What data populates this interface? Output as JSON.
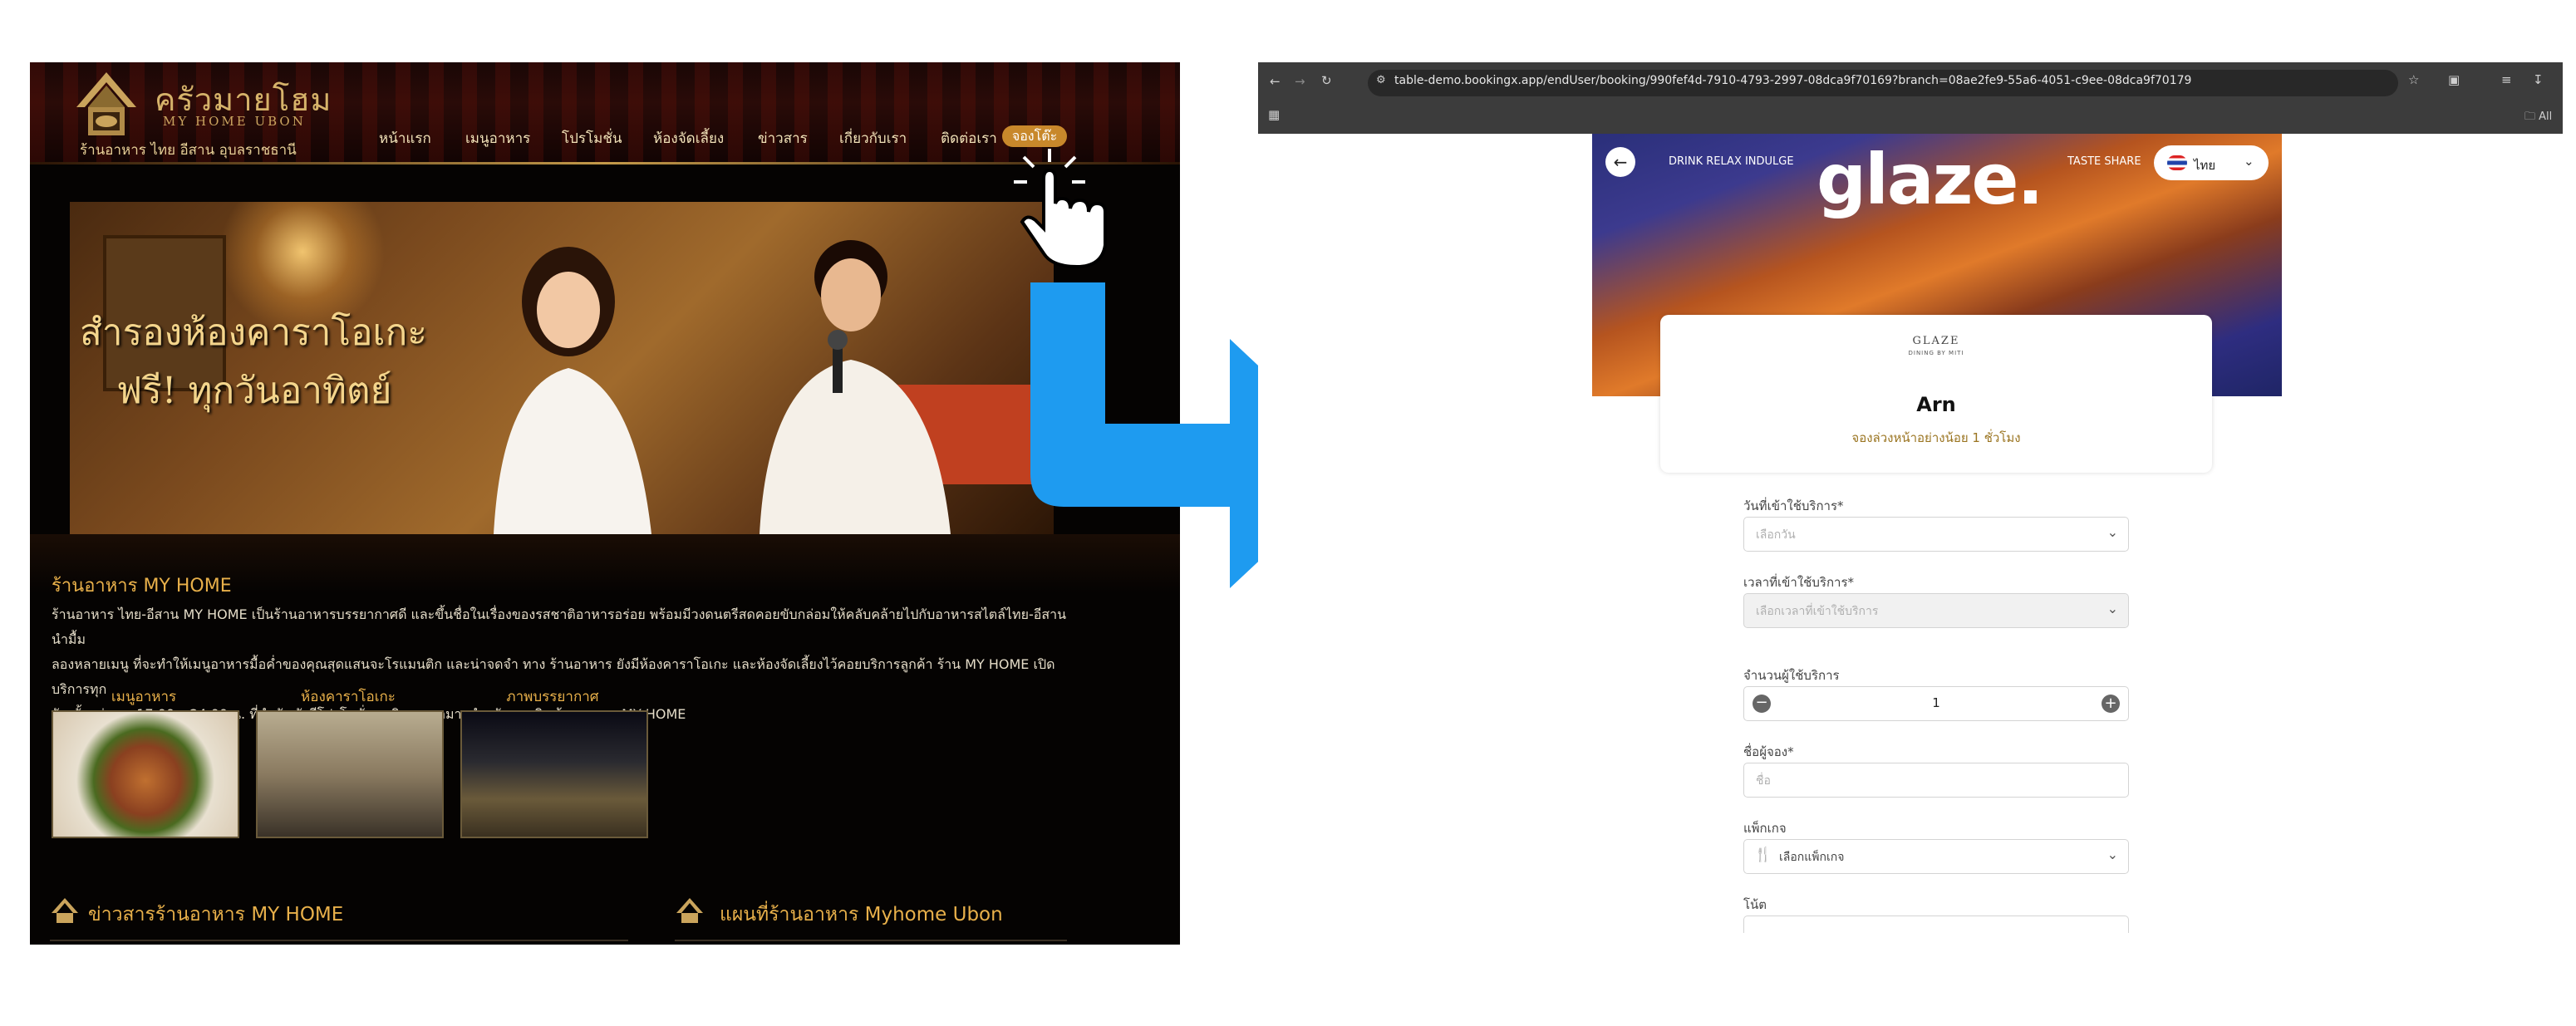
{
  "left_site": {
    "logo": {
      "name": "ครัวมายโฮม",
      "sub": "MY HOME UBON",
      "caption": "ร้านอาหาร ไทย อีสาน อุบลราชธานี"
    },
    "nav": [
      "หน้าแรก",
      "เมนูอาหาร",
      "โปรโมชั่น",
      "ห้องจัดเลี้ยง",
      "ข่าวสาร",
      "เกี่ยวกับเรา",
      "ติดต่อเรา",
      "จองโต๊ะ"
    ],
    "banner": {
      "line1": "สำรองห้องคาราโอเกะ",
      "line2": "ฟรี! ทุกวันอาทิตย์"
    },
    "section_title": "ร้านอาหาร MY HOME",
    "body": [
      "ร้านอาหาร ไทย-อีสาน MY HOME เป็นร้านอาหารบรรยากาศดี และขึ้นชื่อในเรื่องของรสชาติอาหารอร่อย พร้อมมีวงดนตรีสดคอยขับกล่อมให้คลับคล้ายไปกับอาหารสไตล์ไทย-อีสาน นำมื้ม",
      "ลองหลายเมนู ที่จะทำให้เมนูอาหารมื้อค่ำของคุณสุดแสนจะโรแมนติก และน่าจดจำ ทาง ร้านอาหาร ยังมีห้องคาราโอเกะ และห้องจัดเลี้ยงไว้คอยบริการลูกค้า ร้าน MY HOME เปิดบริการทุก",
      "วัน ตั้งแต่เวลา 17.00 – 24.00 น. ที่สำคัญยังมีโปรโมชั่นสุดพิเศษมากมายสำหรับสมาชิก ร้านอาหาร MY HOME"
    ],
    "thumbs": [
      "เมนูอาหาร",
      "ห้องคาราโอเกะ",
      "ภาพบรรยากาศ"
    ],
    "news_title": "ข่าวสารร้านอาหาร MY HOME",
    "map_title": "แผนที่ร้านอาหาร Myhome Ubon"
  },
  "browser": {
    "url": "table-demo.bookingx.app/endUser/booking/990fef4d-7910-4793-2997-08dca9f70169?branch=08ae2fe9-55a6-4051-c9ee-08dca9f70179",
    "bookmarks_label": "All",
    "hero": {
      "nav_left": "DRINK RELAX INDULGE",
      "logo": "glaze.",
      "nav_right": "TASTE SHARE",
      "language": "ไทย"
    },
    "card": {
      "logo": "GLAZE",
      "logo_sub": "DINING BY MITI",
      "title": "Arn",
      "subtitle": "จองล่วงหน้าอย่างน้อย 1 ชั่วโมง"
    },
    "form": {
      "date_label": "วันที่เข้าใช้บริการ*",
      "date_placeholder": "เลือกวัน",
      "time_label": "เวลาที่เข้าใช้บริการ*",
      "time_placeholder": "เลือกเวลาที่เข้าใช้บริการ",
      "guests_label": "จำนวนผู้ใช้บริการ",
      "guests_value": "1",
      "name_label": "ชื่อผู้จอง*",
      "name_placeholder": "ชื่อ",
      "package_label": "แพ็กเกจ",
      "package_placeholder": "เลือกแพ็กเกจ",
      "note_label": "โน้ต"
    }
  },
  "colors": {
    "accent_gold": "#e8b04a",
    "arrow_blue": "#1e9bf0",
    "book_button": "#c8882b"
  }
}
